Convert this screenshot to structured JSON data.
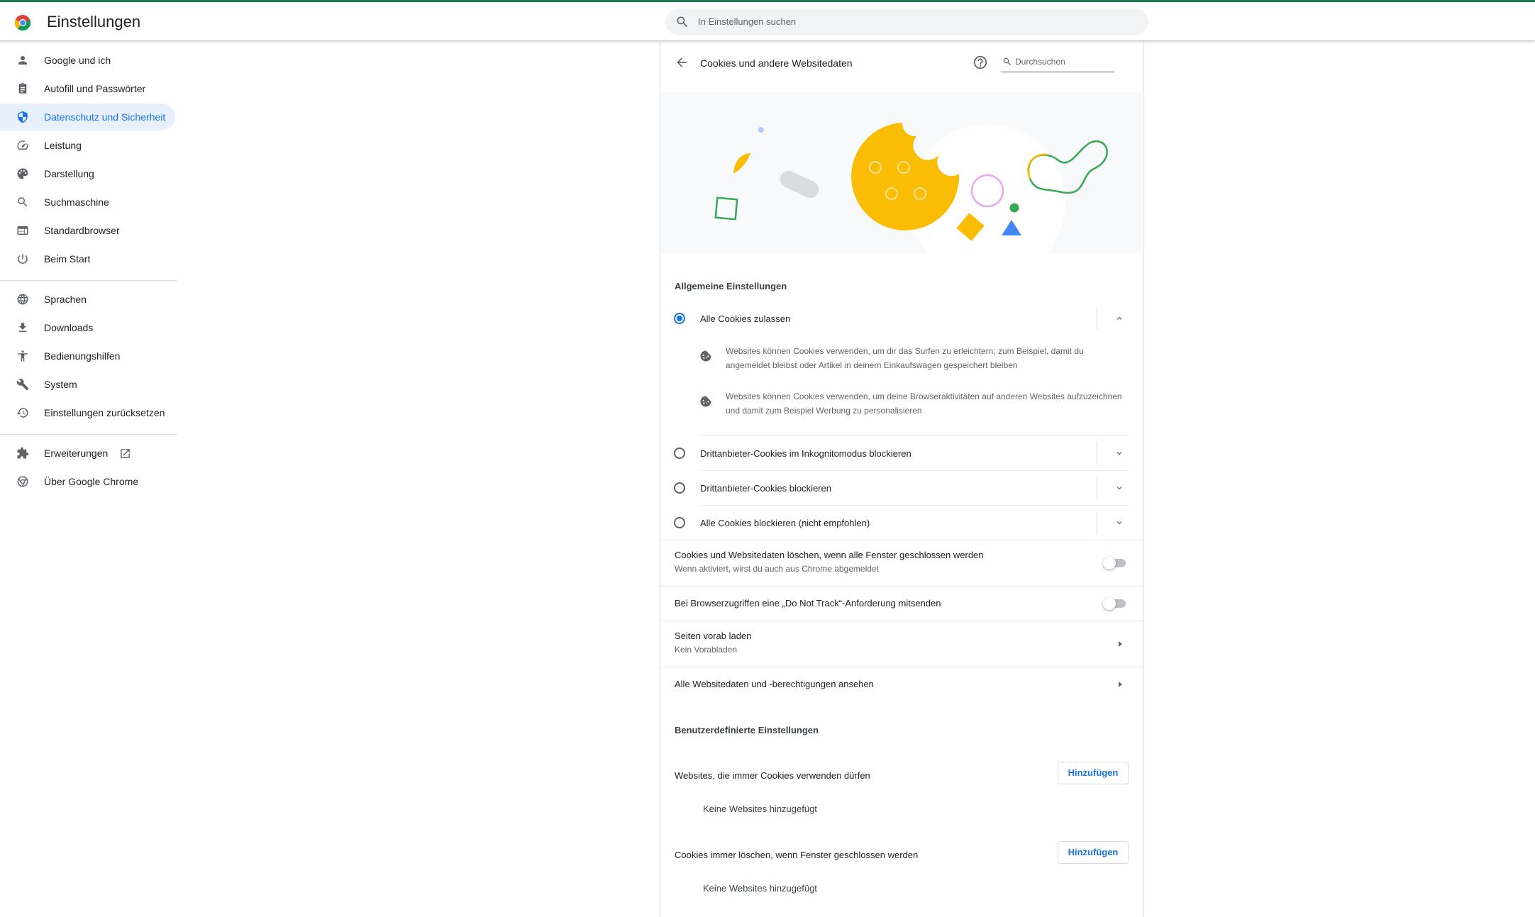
{
  "header": {
    "title": "Einstellungen",
    "search_placeholder": "In Einstellungen suchen"
  },
  "sidebar": {
    "items": [
      {
        "label": "Google und ich",
        "icon": "person-icon"
      },
      {
        "label": "Autofill und Passwörter",
        "icon": "clipboard-icon"
      },
      {
        "label": "Datenschutz und Sicherheit",
        "icon": "shield-icon",
        "active": true
      },
      {
        "label": "Leistung",
        "icon": "speedometer-icon"
      },
      {
        "label": "Darstellung",
        "icon": "palette-icon"
      },
      {
        "label": "Suchmaschine",
        "icon": "search-icon"
      },
      {
        "label": "Standardbrowser",
        "icon": "browser-icon"
      },
      {
        "label": "Beim Start",
        "icon": "power-icon"
      },
      {
        "label": "Sprachen",
        "icon": "globe-icon"
      },
      {
        "label": "Downloads",
        "icon": "download-icon"
      },
      {
        "label": "Bedienungshilfen",
        "icon": "accessibility-icon"
      },
      {
        "label": "System",
        "icon": "wrench-icon"
      },
      {
        "label": "Einstellungen zurücksetzen",
        "icon": "restore-icon"
      },
      {
        "label": "Erweiterungen",
        "icon": "puzzle-icon"
      },
      {
        "label": "Über Google Chrome",
        "icon": "chrome-icon"
      }
    ]
  },
  "page": {
    "title": "Cookies und andere Websitedaten",
    "search_placeholder": "Durchsuchen",
    "general_title": "Allgemeine Einstellungen",
    "options": [
      {
        "label": "Alle Cookies zulassen",
        "selected": true
      },
      {
        "label": "Drittanbieter-Cookies im Inkognitomodus blockieren",
        "selected": false
      },
      {
        "label": "Drittanbieter-Cookies blockieren",
        "selected": false
      },
      {
        "label": "Alle Cookies blockieren (nicht empfohlen)",
        "selected": false
      }
    ],
    "desc1": "Websites können Cookies verwenden, um dir das Surfen zu erleichtern; zum Beispiel, damit du angemeldet bleibst oder Artikel in deinem Einkaufswagen gespeichert bleiben",
    "desc2": "Websites können Cookies verwenden, um deine Browseraktivitäten auf anderen Websites aufzuzeichnen und damit zum Beispiel Werbung zu personalisieren",
    "clear_on_exit": {
      "label": "Cookies und Websitedaten löschen, wenn alle Fenster geschlossen werden",
      "sub": "Wenn aktiviert, wirst du auch aus Chrome abgemeldet",
      "enabled": false
    },
    "dnt": {
      "label": "Bei Browserzugriffen eine „Do Not Track“-Anforderung mitsenden",
      "enabled": false
    },
    "preload": {
      "label": "Seiten vorab laden",
      "sub": "Kein Vorabladen"
    },
    "all_data": "Alle Websitedaten und -berechtigungen ansehen",
    "custom_title": "Benutzerdefinierte Einstellungen",
    "allow_row": "Websites, die immer Cookies verwenden dürfen",
    "clear_row": "Cookies immer löschen, wenn Fenster geschlossen werden",
    "add_label": "Hinzufügen",
    "empty_label": "Keine Websites hinzugefügt"
  },
  "colors": {
    "accent": "#1a73e8",
    "active_bg": "#e8f0fe",
    "topline": "#1e7b4f"
  }
}
